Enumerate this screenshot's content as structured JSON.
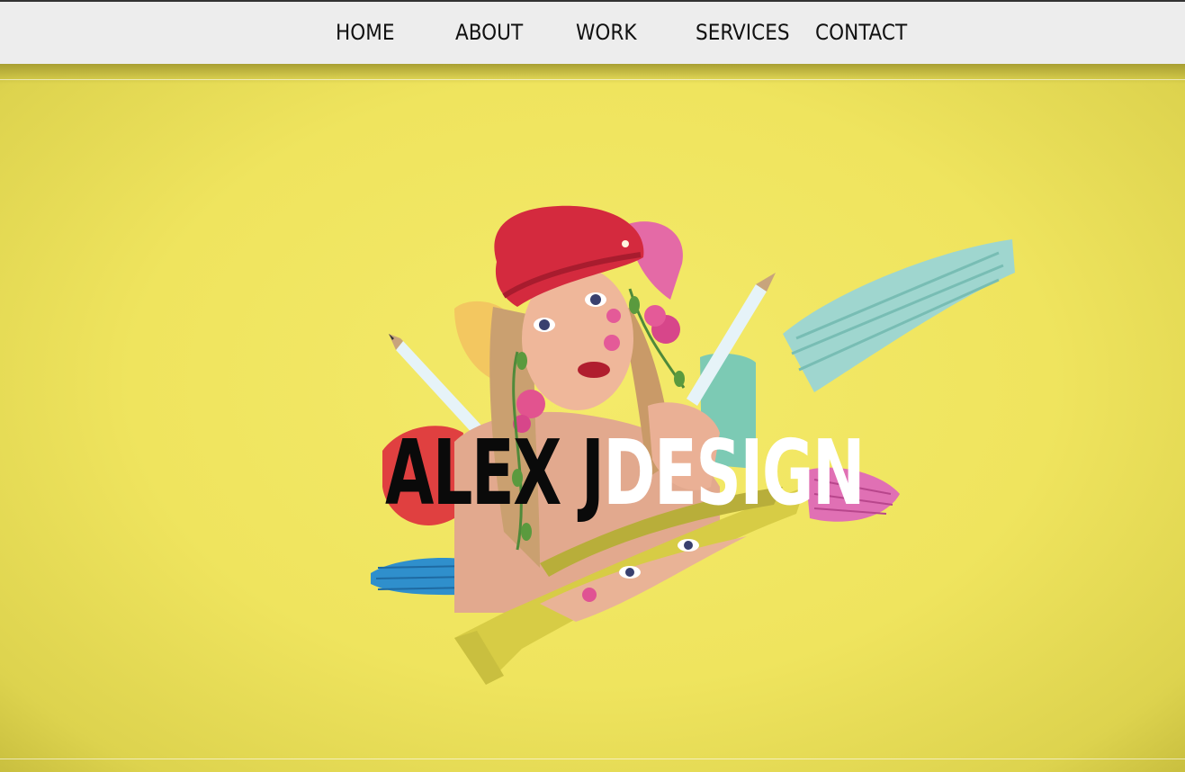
{
  "nav": {
    "items": [
      {
        "label": "HOME"
      },
      {
        "label": "ABOUT"
      },
      {
        "label": "WORK"
      },
      {
        "label": "SERVICES"
      },
      {
        "label": "CONTACT"
      }
    ]
  },
  "hero": {
    "title_first": "ALEX J",
    "title_second": "DESIGN",
    "background_color": "#efe45e",
    "image_description_icon": "portrait-collage"
  }
}
